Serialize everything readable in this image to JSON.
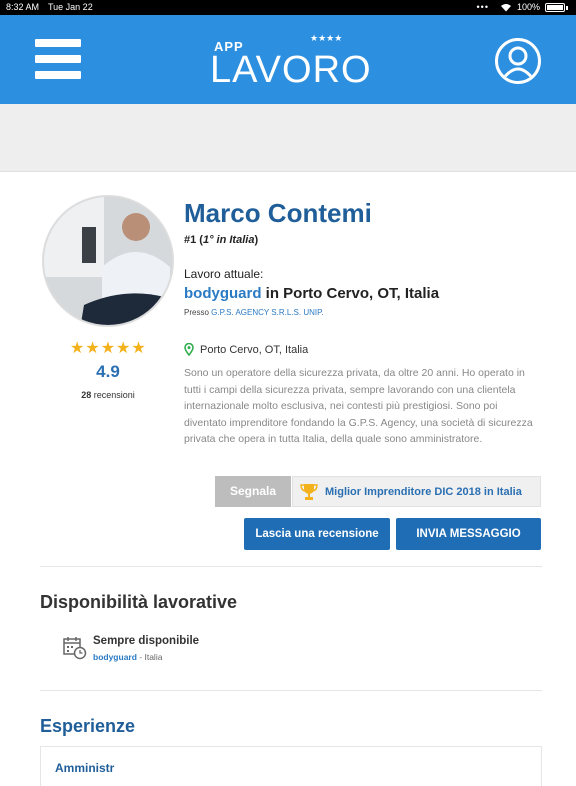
{
  "status_bar": {
    "time": "8:32 AM",
    "date": "Tue Jan 22",
    "dots": "•••",
    "battery": "100%"
  },
  "header": {
    "logo_small": "APP",
    "logo_main": "LAVORO",
    "logo_stars": "★★★★"
  },
  "profile": {
    "name": "Marco Contemi",
    "rank_prefix": "#1 (",
    "rank_italic": "1° in Italia",
    "rank_suffix": ")",
    "job_label": "Lavoro attuale:",
    "job_role": "bodyguard",
    "job_location_text": " in Porto Cervo, OT, Italia",
    "presso_label": "Presso ",
    "company": "G.P.S. AGENCY S.R.L.S. UNIP.",
    "location": "Porto Cervo, OT, Italia",
    "bio": "Sono un operatore della sicurezza privata, da oltre 20 anni. Ho operato in tutti i campi della sicurezza privata, sempre lavorando con una clientela internazionale molto esclusiva, nei contesti più prestigiosi. Sono poi diventato imprenditore fondando la G.P.S. Agency, una società di sicurezza privata che opera in tutta Italia, della quale sono amministratore.",
    "rating_stars": "★★★★★",
    "rating": "4.9",
    "review_count": "28",
    "review_label": " recensioni"
  },
  "actions": {
    "report": "Segnala",
    "award": "Miglior Imprenditore DIC 2018 in Italia",
    "review": "Lascia una recensione",
    "message": "INVIA MESSAGGIO"
  },
  "availability": {
    "title": "Disponibilità lavorative",
    "status": "Sempre disponibile",
    "role": "bodyguard",
    "area": " - Italia"
  },
  "experience": {
    "title": "Esperienze",
    "first_peek": "Amministr"
  },
  "colors": {
    "primary": "#2d8fe0",
    "dark_blue": "#1f5e99",
    "button_blue": "#1f6db5",
    "star": "#f3b21c"
  }
}
